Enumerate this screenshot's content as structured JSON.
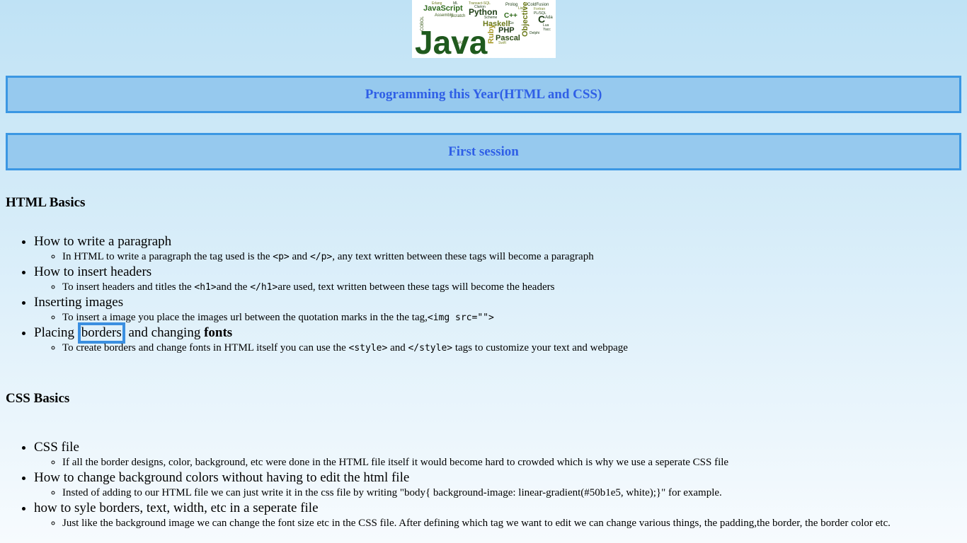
{
  "logo": {
    "words": [
      "Java",
      "JavaScript",
      "Python",
      "Haskell",
      "PHP",
      "Pascal",
      "Ruby",
      "C++",
      "Objective",
      "C",
      "Scratch",
      "Assembly",
      "COBOL",
      "SAS",
      "Prolog",
      "ColdFusion",
      "Fortran",
      "Delphi",
      "Erlang",
      "ML",
      "Scheme",
      "Transact-SQL",
      "Lisp",
      "Ada",
      "Clarion",
      "Dart",
      "Go",
      "Lua",
      "PL/SQL",
      "Yacc",
      "Swift"
    ]
  },
  "banners": {
    "title": "Programming this Year(HTML and CSS)",
    "session": "First session"
  },
  "html_section": {
    "heading": "HTML Basics",
    "items": [
      {
        "title": "How to write a paragraph",
        "detail": {
          "pre": "In HTML to write a paragraph the tag used is the ",
          "code1": "<p>",
          "mid": " and ",
          "code2": "</p>",
          "post": ", any text written between these tags will become a paragraph"
        }
      },
      {
        "title": "How to insert headers",
        "detail": {
          "pre": "To insert headers and titles the ",
          "code1": "<h1>",
          "mid": "and the ",
          "code2": "</h1>",
          "post": "are used, text written between these tags will become the headers"
        }
      },
      {
        "title": "Inserting images",
        "detail": {
          "pre": "To insert a image you place the images url between the quotation marks in the the tag,",
          "code1": "<img src=\"\">"
        }
      },
      {
        "title_pre": "Placing ",
        "title_boxed": "borders",
        "title_mid": " and changing ",
        "title_bold": "fonts",
        "detail": {
          "pre": "To create borders and change fonts in HTML itself you can use the ",
          "code1": "<style>",
          "mid": " and ",
          "code2": "</style>",
          "post": " tags to customize your text and webpage"
        }
      }
    ]
  },
  "css_section": {
    "heading": "CSS Basics",
    "items": [
      {
        "title": "CSS file",
        "detail": "If all the border designs, color, background, etc were done in the HTML file itself it would become hard to crowded which is why we use a seperate CSS file"
      },
      {
        "title": "How to change background colors without having to edit the html file",
        "detail": "Insted of adding to our HTML file we can just write it in the css file by writing \"body{ background-image: linear-gradient(#50b1e5, white);}\" for example."
      },
      {
        "title": "how to syle borders, text, width, etc in a seperate file",
        "detail": "Just like the background image we can change the font size etc in the CSS file. After defining which tag we want to edit we can change various things, the padding,the border, the border color etc."
      }
    ]
  },
  "colors": {
    "banner_border": "#3b97e3",
    "banner_fill": "#96c9ee",
    "banner_text": "#2f5fe6",
    "box_border": "#3b8fe0"
  }
}
